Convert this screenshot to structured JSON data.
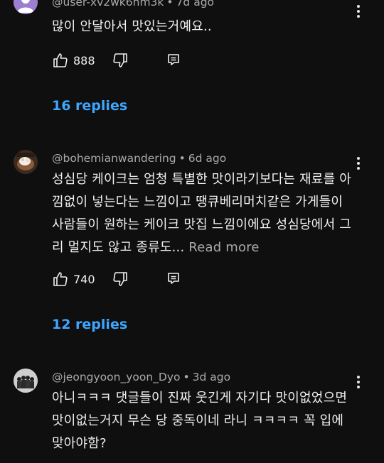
{
  "comments": [
    {
      "author": "@user-xv2wk6hm3k",
      "time": "7d ago",
      "text": "많이 안달아서 맛있는거예요..",
      "more": "",
      "likes": "888",
      "replies": "16 replies",
      "avatar": "purple-default-avatar"
    },
    {
      "author": "@bohemianwandering",
      "time": "6d ago",
      "text": "성심당 케이크는 엄청 특별한 맛이라기보다는 재료를 아낌없이 넣는다는 느낌이고 땡큐베리머치같은 가게들이 사람들이 원하는 케이크 맛집 느낌이에요 성심당에서 그리 멀지도 않고 종류도...",
      "more": "Read more",
      "likes": "740",
      "replies": "12 replies",
      "avatar": "photo-avatar"
    },
    {
      "author": "@jeongyoon_yoon_Dyo",
      "time": "3d ago",
      "text": "아니ㅋㅋㅋ 댓글들이 진짜 웃긴게 자기다 맛이없었으면 맛이없는거지 무슨 당 중독이네 라니 ㅋㅋㅋㅋ 꼭 입에 맞아야함?",
      "more": "",
      "likes": "",
      "replies": "",
      "avatar": "group-photo-avatar"
    }
  ],
  "icons": {
    "like": "thumbs-up-icon",
    "dislike": "thumbs-down-icon",
    "reply": "reply-icon",
    "menu": "more-vert-icon"
  },
  "colors": {
    "background": "#0f0f0f",
    "text": "#f1f1f1",
    "secondary": "#aaaaaa",
    "link": "#3ea6ff",
    "avatar_purple": "#9c7fd1"
  }
}
